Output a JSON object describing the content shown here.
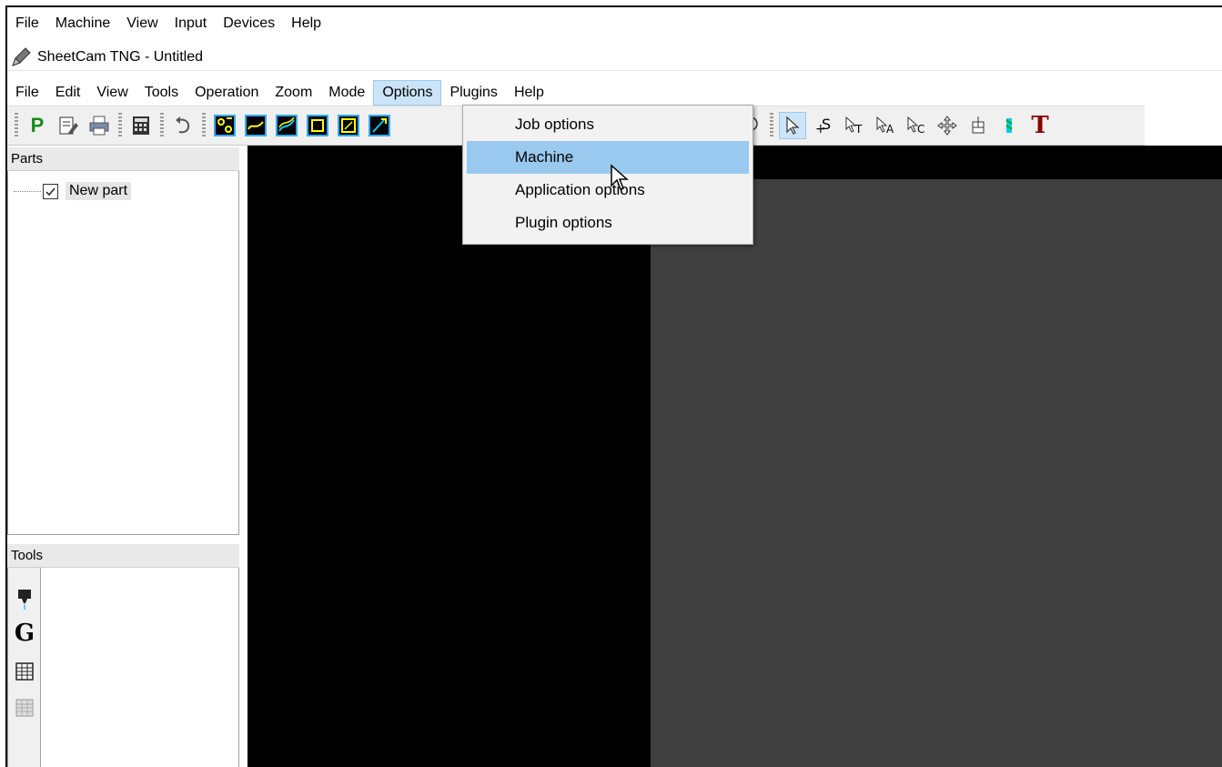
{
  "outer_menu": [
    "File",
    "Machine",
    "View",
    "Input",
    "Devices",
    "Help"
  ],
  "window": {
    "title": "SheetCam TNG - Untitled",
    "icon": "pencil-icon"
  },
  "app_menu": [
    "File",
    "Edit",
    "View",
    "Tools",
    "Operation",
    "Zoom",
    "Mode",
    "Options",
    "Plugins",
    "Help"
  ],
  "app_menu_active": "Options",
  "toolbar": {
    "left_icons": [
      "p-icon",
      "edit-icon",
      "print-icon",
      "calculator-icon",
      "undo-icon"
    ],
    "operation_icons": [
      "drill-op-icon",
      "path-op-icon",
      "profile-op-icon",
      "square-op-icon",
      "pocket-op-icon",
      "pen-op-icon"
    ],
    "view_icons": [
      "map-pin-icon",
      "map-pin-2-icon"
    ],
    "mode_icons": [
      "select-icon",
      "add-start-icon",
      "select-text-icon",
      "select-area-icon",
      "select-contour-icon",
      "move-icon",
      "rotate-icon",
      "tool-color-icon",
      "text-icon"
    ],
    "text_glyph": "T",
    "p_glyph": "P"
  },
  "parts_panel": {
    "title": "Parts",
    "items": [
      {
        "label": "New part",
        "checked": true
      }
    ]
  },
  "tools_panel": {
    "title": "Tools",
    "glyph_g": "G"
  },
  "options_dropdown": {
    "items": [
      "Job options",
      "Machine",
      "Application options",
      "Plugin options"
    ],
    "hovered": "Machine"
  },
  "colors": {
    "canvas_black": "#000000",
    "canvas_gray": "#404040",
    "highlight": "#99c9ef",
    "active_menu": "#cce4f7"
  }
}
